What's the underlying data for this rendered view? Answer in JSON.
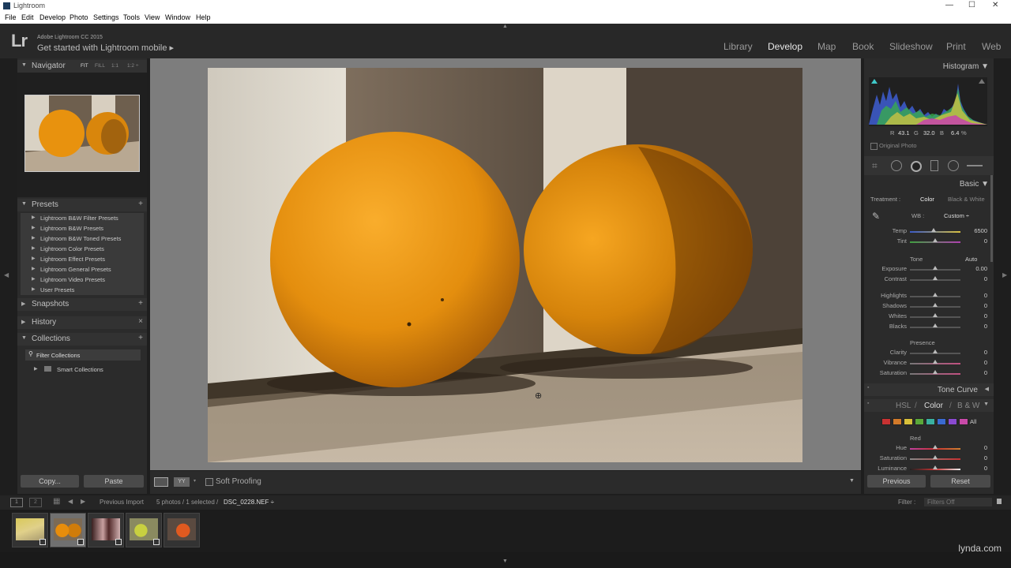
{
  "window": {
    "title": "Lightroom",
    "controls": [
      "—",
      "☐",
      "✕"
    ]
  },
  "menu": [
    "File",
    "Edit",
    "Develop",
    "Photo",
    "Settings",
    "Tools",
    "View",
    "Window",
    "Help"
  ],
  "identity": {
    "logo": "Lr",
    "version": "Adobe Lightroom CC 2015",
    "mobile": "Get started with Lightroom mobile ▸"
  },
  "modules": [
    "Library",
    "Develop",
    "Map",
    "Book",
    "Slideshow",
    "Print",
    "Web"
  ],
  "active_module": "Develop",
  "left": {
    "navigator": {
      "title": "Navigator",
      "zoom": [
        "FIT",
        "FILL",
        "1:1",
        "1:2 ÷"
      ]
    },
    "presets": {
      "title": "Presets",
      "add": "+",
      "items": [
        "Lightroom B&W Filter Presets",
        "Lightroom B&W Presets",
        "Lightroom B&W Toned Presets",
        "Lightroom Color Presets",
        "Lightroom Effect Presets",
        "Lightroom General Presets",
        "Lightroom Video Presets",
        "User Presets"
      ]
    },
    "snapshots": {
      "title": "Snapshots",
      "add": "+"
    },
    "history": {
      "title": "History",
      "clear": "×"
    },
    "collections": {
      "title": "Collections",
      "add": "+",
      "filter": "Filter Collections",
      "smart": "Smart Collections"
    },
    "copy_label": "Copy...",
    "paste_label": "Paste"
  },
  "toolbar": {
    "soft_proofing": "Soft Proofing"
  },
  "right": {
    "histogram": {
      "title": "Histogram",
      "readout": {
        "r_label": "R",
        "r": "43.1",
        "g_label": "G",
        "g": "32.0",
        "b_label": "B",
        "b": "6.4",
        "pct": "%"
      },
      "original_photo": "Original Photo"
    },
    "basic": {
      "title": "Basic",
      "treatment_label": "Treatment :",
      "treatment_color": "Color",
      "treatment_bw": "Black & White",
      "wb_label": "WB :",
      "wb_value": "Custom ÷",
      "temp": {
        "label": "Temp",
        "value": "6500",
        "pos": 0.47
      },
      "tint": {
        "label": "Tint",
        "value": "0",
        "pos": 0.5
      },
      "tone_label": "Tone",
      "auto_label": "Auto",
      "exposure": {
        "label": "Exposure",
        "value": "0.00",
        "pos": 0.5
      },
      "contrast": {
        "label": "Contrast",
        "value": "0",
        "pos": 0.5
      },
      "highlights": {
        "label": "Highlights",
        "value": "0",
        "pos": 0.5
      },
      "shadows": {
        "label": "Shadows",
        "value": "0",
        "pos": 0.5
      },
      "whites": {
        "label": "Whites",
        "value": "0",
        "pos": 0.5
      },
      "blacks": {
        "label": "Blacks",
        "value": "0",
        "pos": 0.5
      },
      "presence_label": "Presence",
      "clarity": {
        "label": "Clarity",
        "value": "0",
        "pos": 0.5
      },
      "vibrance": {
        "label": "Vibrance",
        "value": "0",
        "pos": 0.5
      },
      "saturation": {
        "label": "Saturation",
        "value": "0",
        "pos": 0.5
      }
    },
    "tone_curve": {
      "title": "Tone Curve"
    },
    "hsl": {
      "hsl_label": "HSL",
      "sep": "/",
      "color_label": "Color",
      "bw_label": "B & W",
      "all_label": "All",
      "swatches": [
        "#c83232",
        "#d27a2a",
        "#d8c03a",
        "#5aa83a",
        "#3ab0a0",
        "#3a6ad0",
        "#8a4ad0",
        "#c84aa8"
      ],
      "red_label": "Red",
      "hue": {
        "label": "Hue",
        "value": "0",
        "pos": 0.5
      },
      "sat": {
        "label": "Saturation",
        "value": "0",
        "pos": 0.5
      },
      "lum": {
        "label": "Luminance",
        "value": "0",
        "pos": 0.5
      }
    },
    "previous_label": "Previous",
    "reset_label": "Reset"
  },
  "filmstrip": {
    "page1": "1",
    "page2": "2",
    "source": "Previous Import",
    "info": "5 photos / 1 selected /",
    "filename": "DSC_0228.NEF ÷",
    "filter_label": "Filter :",
    "filter_value": "Filters Off"
  },
  "watermark": "lynda.com"
}
